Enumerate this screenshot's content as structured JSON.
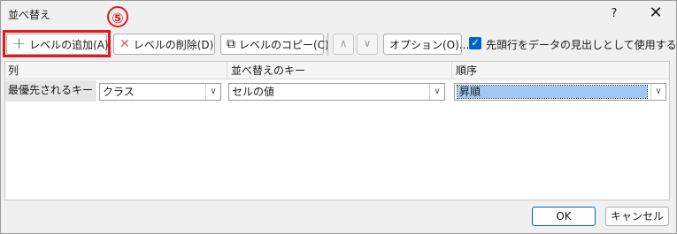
{
  "window": {
    "title": "並べ替え",
    "help": "?",
    "close": "✕"
  },
  "annotation": {
    "step": "⑤"
  },
  "toolbar": {
    "add_level": "レベルの追加(A)",
    "delete_level": "レベルの削除(D)",
    "copy_level": "レベルのコピー(C)",
    "move_up": "∧",
    "move_down": "∨",
    "options": "オプション(O)...",
    "header_checkbox_label": "先頭行をデータの見出しとして使用する(H)",
    "header_checkbox_checked": true
  },
  "grid": {
    "headers": {
      "column": "列",
      "sort_on": "並べ替えのキー",
      "order": "順序"
    },
    "rows": [
      {
        "label": "最優先されるキー",
        "column": "クラス",
        "sort_on": "セルの値",
        "order": "昇順"
      }
    ]
  },
  "footer": {
    "ok": "OK",
    "cancel": "キャンセル"
  },
  "colors": {
    "accent": "#0067c0",
    "highlight": "#e11b1b",
    "selection": "#9fc9f4"
  },
  "icons": [
    "plus-icon",
    "delete-x-icon",
    "copy-icon",
    "chevron-down-icon",
    "close-icon",
    "help-icon",
    "checkmark-icon"
  ]
}
